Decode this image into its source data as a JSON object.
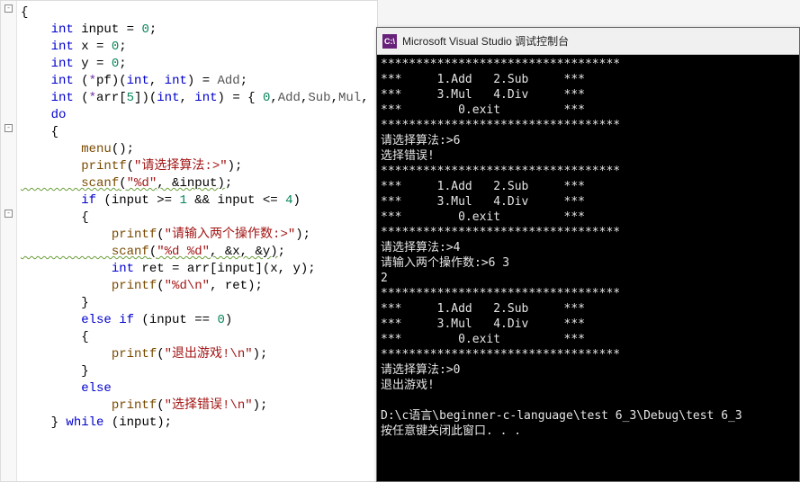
{
  "editor": {
    "lines": [
      [
        [
          "n",
          "{"
        ]
      ],
      [
        [
          "t",
          "    int "
        ],
        [
          "n",
          "input = "
        ],
        [
          "num",
          "0"
        ],
        [
          "n",
          ";"
        ]
      ],
      [
        [
          "t",
          "    int "
        ],
        [
          "n",
          "x = "
        ],
        [
          "num",
          "0"
        ],
        [
          "n",
          ";"
        ]
      ],
      [
        [
          "t",
          "    int "
        ],
        [
          "n",
          "y = "
        ],
        [
          "num",
          "0"
        ],
        [
          "n",
          ";"
        ]
      ],
      [
        [
          "t",
          "    int "
        ],
        [
          "n",
          "("
        ],
        [
          "p",
          "*"
        ],
        [
          "n",
          "pf)("
        ],
        [
          "t",
          "int"
        ],
        [
          "n",
          ", "
        ],
        [
          "t",
          "int"
        ],
        [
          "n",
          ") = "
        ],
        [
          "id",
          "Add"
        ],
        [
          "n",
          ";"
        ]
      ],
      [
        [
          "t",
          "    int "
        ],
        [
          "n",
          "("
        ],
        [
          "p",
          "*"
        ],
        [
          "n",
          "arr["
        ],
        [
          "num",
          "5"
        ],
        [
          "n",
          "])("
        ],
        [
          "t",
          "int"
        ],
        [
          "n",
          ", "
        ],
        [
          "t",
          "int"
        ],
        [
          "n",
          ") = { "
        ],
        [
          "num",
          "0"
        ],
        [
          "n",
          ","
        ],
        [
          "id",
          "Add"
        ],
        [
          "n",
          ","
        ],
        [
          "id",
          "Sub"
        ],
        [
          "n",
          ","
        ],
        [
          "id",
          "Mul"
        ],
        [
          "n",
          ","
        ]
      ],
      [
        [
          "k",
          "    do"
        ]
      ],
      [
        [
          "n",
          "    {"
        ]
      ],
      [
        [
          "fn",
          "        menu"
        ],
        [
          "n",
          "();"
        ]
      ],
      [
        [
          "fn",
          "        printf"
        ],
        [
          "n",
          "("
        ],
        [
          "s",
          "\"请选择算法:>\""
        ],
        [
          "n",
          ");"
        ]
      ],
      [
        [
          "fn underline",
          "        scanf"
        ],
        [
          "n underline",
          "("
        ],
        [
          "s underline",
          "\"%d\""
        ],
        [
          "n underline",
          ", &input)"
        ],
        [
          "n",
          ";"
        ]
      ],
      [
        [
          "k",
          "        if "
        ],
        [
          "n",
          "(input >= "
        ],
        [
          "num",
          "1"
        ],
        [
          "n",
          " && input <= "
        ],
        [
          "num",
          "4"
        ],
        [
          "n",
          ")"
        ]
      ],
      [
        [
          "n",
          "        {"
        ]
      ],
      [
        [
          "fn",
          "            printf"
        ],
        [
          "n",
          "("
        ],
        [
          "s",
          "\"请输入两个操作数:>\""
        ],
        [
          "n",
          ");"
        ]
      ],
      [
        [
          "fn underline",
          "            scanf"
        ],
        [
          "n underline",
          "("
        ],
        [
          "s underline",
          "\"%d %d\""
        ],
        [
          "n underline",
          ", &x, &y)"
        ],
        [
          "n",
          ";"
        ]
      ],
      [
        [
          "t",
          "            int "
        ],
        [
          "n",
          "ret = arr[input](x, y);"
        ]
      ],
      [
        [
          "fn",
          "            printf"
        ],
        [
          "n",
          "("
        ],
        [
          "s",
          "\"%d\\n\""
        ],
        [
          "n",
          ", ret);"
        ]
      ],
      [
        [
          "n",
          "        }"
        ]
      ],
      [
        [
          "k",
          "        else if "
        ],
        [
          "n",
          "(input == "
        ],
        [
          "num",
          "0"
        ],
        [
          "n",
          ")"
        ]
      ],
      [
        [
          "n",
          "        {"
        ]
      ],
      [
        [
          "fn",
          "            printf"
        ],
        [
          "n",
          "("
        ],
        [
          "s",
          "\"退出游戏!\\n\""
        ],
        [
          "n",
          ");"
        ]
      ],
      [
        [
          "n",
          "        }"
        ]
      ],
      [
        [
          "k",
          "        else"
        ]
      ],
      [
        [
          "fn",
          "            printf"
        ],
        [
          "n",
          "("
        ],
        [
          "s",
          "\"选择错误!\\n\""
        ],
        [
          "n",
          ");"
        ]
      ],
      [
        [
          "n",
          "    } "
        ],
        [
          "k",
          "while "
        ],
        [
          "n",
          "(input);"
        ]
      ]
    ],
    "fold_positions": [
      1,
      120,
      235
    ]
  },
  "console": {
    "title": "Microsoft Visual Studio 调试控制台",
    "icon_text": "C:\\",
    "lines": [
      "**********************************",
      "***     1.Add   2.Sub     ***",
      "***     3.Mul   4.Div     ***",
      "***        0.exit         ***",
      "**********************************",
      "请选择算法:>6",
      "选择错误!",
      "**********************************",
      "***     1.Add   2.Sub     ***",
      "***     3.Mul   4.Div     ***",
      "***        0.exit         ***",
      "**********************************",
      "请选择算法:>4",
      "请输入两个操作数:>6 3",
      "2",
      "**********************************",
      "***     1.Add   2.Sub     ***",
      "***     3.Mul   4.Div     ***",
      "***        0.exit         ***",
      "**********************************",
      "请选择算法:>0",
      "退出游戏!",
      "",
      "D:\\c语言\\beginner-c-language\\test 6_3\\Debug\\test 6_3",
      "按任意键关闭此窗口. . ."
    ]
  }
}
